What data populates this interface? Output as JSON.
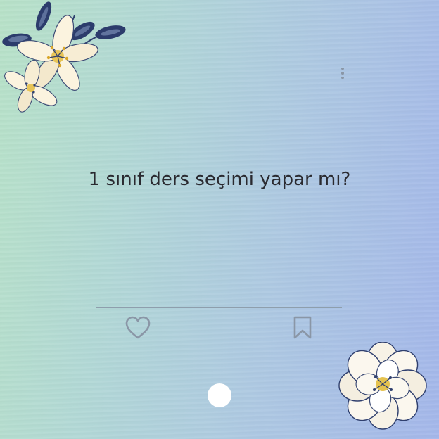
{
  "card": {
    "question": "1 sınıf ders seçimi yapar mı?"
  },
  "icons": {
    "menu": "more-vertical-icon",
    "like": "heart-icon",
    "bookmark": "bookmark-icon"
  },
  "colors": {
    "background_start": "#b8e2c8",
    "background_end": "#a4b7ea",
    "text": "#2a2a30",
    "icon": "#8a96a6",
    "pagination_dot": "#ffffff"
  },
  "pagination": {
    "current_page": 1
  }
}
